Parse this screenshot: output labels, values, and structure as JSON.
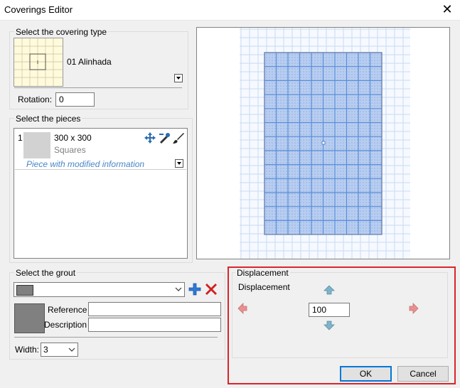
{
  "window": {
    "title": "Coverings Editor",
    "close_glyph": "✕"
  },
  "covering_type": {
    "group_label": "Select the covering type",
    "selected_name": "01 Alinhada",
    "rotation_label": "Rotation:",
    "rotation_value": "0"
  },
  "pieces": {
    "group_label": "Select the pieces",
    "items": [
      {
        "index": "1",
        "size": "300 x 300",
        "type": "Squares",
        "note": "Piece with modified information"
      }
    ]
  },
  "grout": {
    "group_label": "Select the grout",
    "reference_label": "Reference",
    "reference_value": "",
    "description_label": "Description",
    "description_value": "",
    "width_label": "Width:",
    "width_value": "3",
    "swatch_color": "#808080",
    "add_icon": "plus-icon",
    "delete_icon": "delete-x-icon"
  },
  "displacement": {
    "group_label": "Displacement",
    "inner_label": "Displacement",
    "value": "100",
    "highlight_color": "#d9252c"
  },
  "buttons": {
    "ok": "OK",
    "cancel": "Cancel"
  },
  "colors": {
    "tile_fill": "#b8cdf0",
    "grid_line": "#5a8fd8",
    "accent": "#0078d7",
    "note_text": "#4a86c7"
  }
}
